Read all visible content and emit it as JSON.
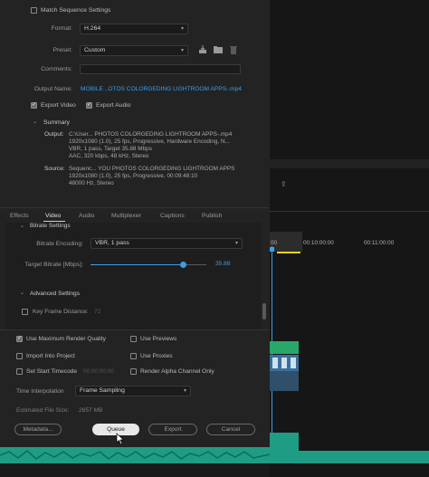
{
  "export": {
    "match_sequence_label": "Match Sequence Settings",
    "format_label": "Format:",
    "format_value": "H.264",
    "preset_label": "Preset:",
    "preset_value": "Custom",
    "comments_label": "Comments:",
    "comments_value": "",
    "output_name_label": "Output Name:",
    "output_name_value": "MOBILE ..OTOS COLORGEDING LIGHTROOM APPS-.mp4",
    "export_video_label": "Export Video",
    "export_audio_label": "Export Audio",
    "summary_title": "Summary",
    "output_key": "Output:",
    "output_lines": [
      "C:\\User... PHOTOS COLORGEDING LIGHTROOM APPS-.mp4",
      "1920x1080 (1.0), 25 fps, Progressive, Hardware Encoding, N...",
      "VBR, 1 pass, Target 35.88 Mbps",
      "AAC, 320 kbps, 48 kHz, Stereo"
    ],
    "source_key": "Source:",
    "source_lines": [
      "Sequenc... YOU PHOTOS COLORGEDING LIGHTROOM APPS",
      "1920x1080 (1.0), 25 fps, Progressive, 00:09:48:10",
      "48000 Hz, Stereo"
    ]
  },
  "tabs": [
    "Effects",
    "Video",
    "Audio",
    "Multiplexer",
    "Captions",
    "Publish"
  ],
  "bitrate": {
    "section_title": "Bitrate Settings",
    "encoding_label": "Bitrate Encoding:",
    "encoding_value": "VBR, 1 pass",
    "target_label": "Target Bitrate [Mbps]:",
    "target_value": "35.88",
    "target_fraction": 0.8
  },
  "advanced": {
    "section_title": "Advanced Settings",
    "keyframe_label": "Key Frame Distance:",
    "keyframe_value": "72"
  },
  "options": {
    "max_render_quality": "Use Maximum Render Quality",
    "use_previews": "Use Previews",
    "import_into_project": "Import Into Project",
    "use_proxies": "Use Proxies",
    "set_start_timecode": "Set Start Timecode",
    "start_timecode_value": "00:00:00:00",
    "render_alpha": "Render Alpha Channel Only",
    "time_interpolation_label": "Time Interpolation",
    "time_interpolation_value": "Frame Sampling",
    "estimated_size_label": "Estimated File Size:",
    "estimated_size_value": "2657 MB"
  },
  "buttons": {
    "metadata": "Metadata...",
    "queue": "Queue",
    "export": "Export",
    "cancel": "Cancel"
  },
  "timeline": {
    "timecodes": [
      "00",
      "00:10:00:00",
      "00:11:00:00"
    ]
  },
  "colors": {
    "accent_blue": "#3b9ee8",
    "clip_green": "#27a86a",
    "audio_teal": "#1f9c84"
  }
}
